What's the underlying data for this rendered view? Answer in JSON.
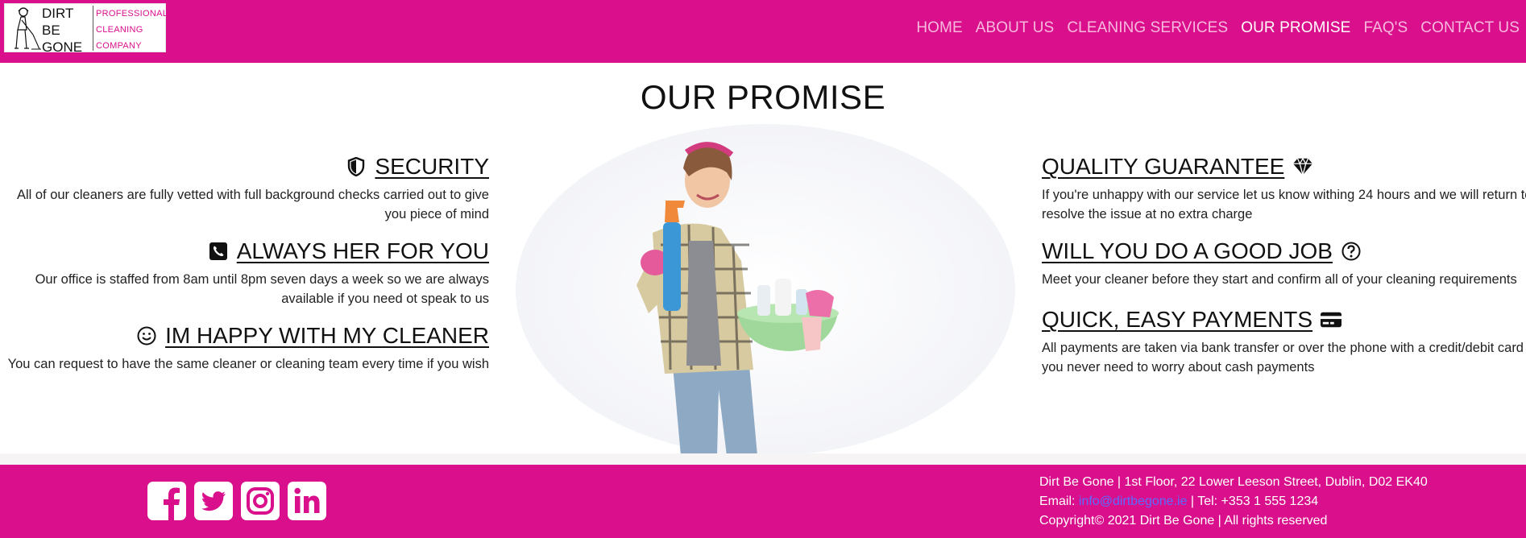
{
  "brand": {
    "name_lines": [
      "DIRT",
      "BE",
      "GONE"
    ],
    "tagline_lines": [
      "PROFESSIONAL",
      "CLEANING",
      "COMPANY"
    ]
  },
  "nav": {
    "items": [
      {
        "label": "HOME",
        "active": false
      },
      {
        "label": "ABOUT US",
        "active": false
      },
      {
        "label": "CLEANING SERVICES",
        "active": false
      },
      {
        "label": "OUR PROMISE",
        "active": true
      },
      {
        "label": "FAQ'S",
        "active": false
      },
      {
        "label": "CONTACT US",
        "active": false
      }
    ]
  },
  "page": {
    "title": "OUR PROMISE"
  },
  "promises_left": [
    {
      "icon": "shield-icon",
      "title": "SECURITY",
      "text": "All of our cleaners are fully vetted with full background checks carried out to give you piece of mind"
    },
    {
      "icon": "phone-icon",
      "title": "ALWAYS HER FOR YOU",
      "text": "Our office is staffed from 8am until 8pm seven days a week so we are always available if you need ot speak to us"
    },
    {
      "icon": "smile-icon",
      "title": "IM HAPPY WITH MY CLEANER",
      "text": "You can request to have the same cleaner or cleaning team every time if you wish"
    }
  ],
  "promises_right": [
    {
      "icon": "diamond-icon",
      "title": "QUALITY GUARANTEE",
      "text": "If you're unhappy with our service let us know withing 24 hours and we will return to resolve the issue at no extra charge"
    },
    {
      "icon": "question-icon",
      "title": "WILL YOU DO A GOOD JOB",
      "text": "Meet your cleaner before they start and confirm all of your cleaning requirements"
    },
    {
      "icon": "credit-card-icon",
      "title": "QUICK, EASY PAYMENTS",
      "text": "All payments are taken via bank transfer or over the phone with a credit/debit card so you never need to worry about cash payments"
    }
  ],
  "footer": {
    "address": "Dirt Be Gone | 1st Floor, 22 Lower Leeson Street, Dublin, D02 EK40",
    "email_label": "Email: ",
    "email": "info@dirtbegone.ie",
    "phone": " | Tel: +353 1 555 1234",
    "copyright": "Copyright© 2021 Dirt Be Gone | All rights reserved",
    "social": [
      "facebook-icon",
      "twitter-icon",
      "instagram-icon",
      "linkedin-icon"
    ]
  },
  "colors": {
    "brand": "#d90f8c",
    "nav_inactive": "#f7b9de",
    "nav_active": "#ffffff",
    "link": "#5b6cff"
  }
}
